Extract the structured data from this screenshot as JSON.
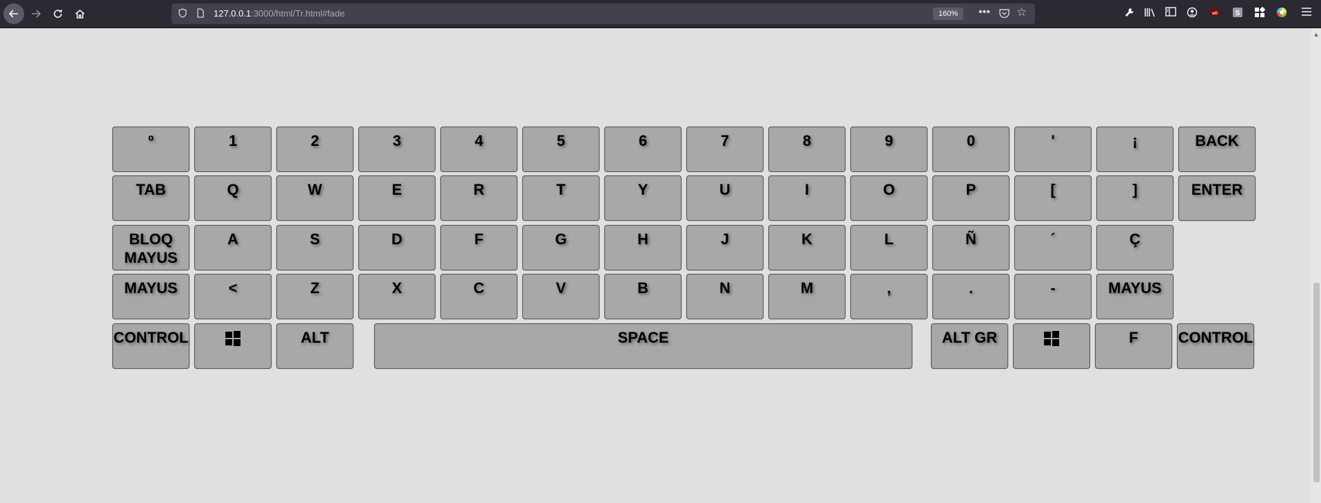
{
  "browser": {
    "url_host": "127.0.0.1",
    "url_rest": ":3000/html/Tr.html#fade",
    "zoom": "160%"
  },
  "keyboard": {
    "rows": [
      [
        "º",
        "1",
        "2",
        "3",
        "4",
        "5",
        "6",
        "7",
        "8",
        "9",
        "0",
        "'",
        "¡",
        "BACK"
      ],
      [
        "TAB",
        "Q",
        "W",
        "E",
        "R",
        "T",
        "Y",
        "U",
        "I",
        "O",
        "P",
        "[",
        "]",
        "ENTER"
      ],
      [
        "BLOQ MAYUS",
        "A",
        "S",
        "D",
        "F",
        "G",
        "H",
        "J",
        "K",
        "L",
        "Ñ",
        "´",
        "Ç"
      ],
      [
        "MAYUS",
        "<",
        "Z",
        "X",
        "C",
        "V",
        "B",
        "N",
        "M",
        ",",
        ".",
        "-",
        "MAYUS"
      ],
      [
        "CONTROL",
        "",
        "ALT",
        "SPACE",
        "ALT GR",
        "",
        "F",
        "CONTROL"
      ]
    ]
  },
  "colors": {
    "background": "#e0e0e0",
    "key": "#a8a8a8",
    "toolbar": "#2b2a33"
  }
}
